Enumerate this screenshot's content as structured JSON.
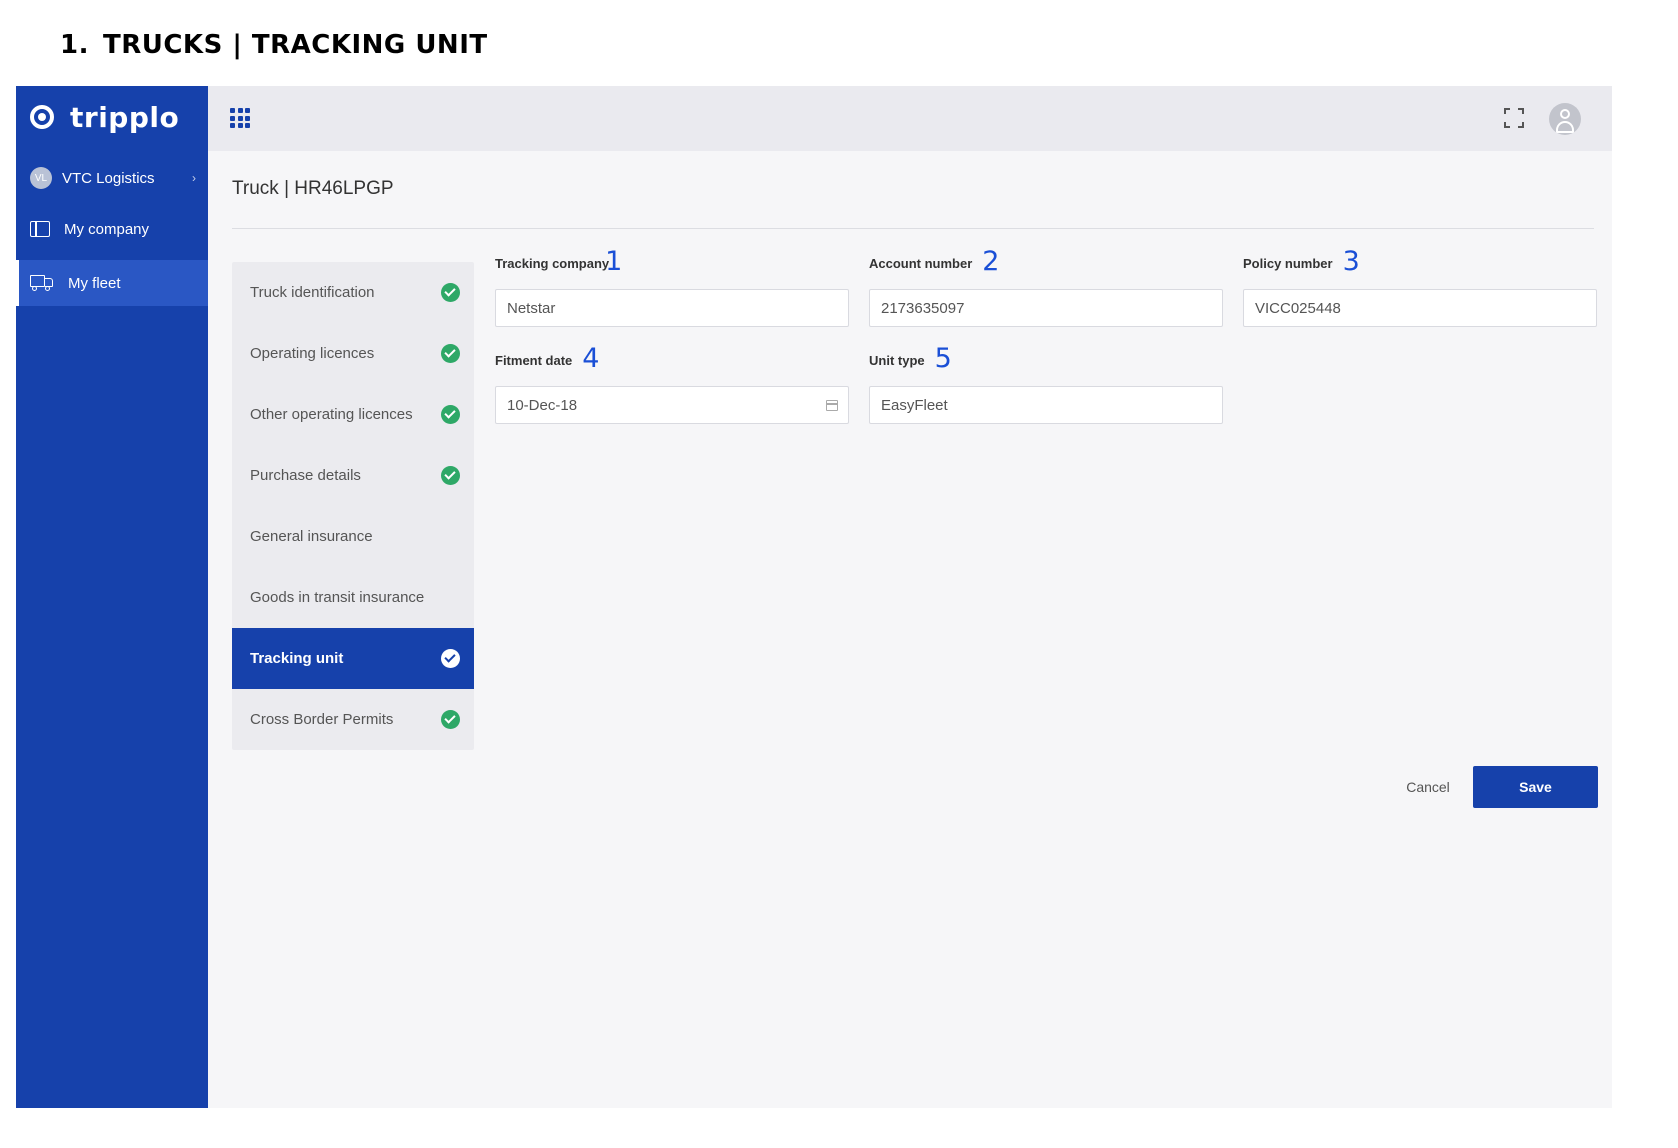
{
  "document": {
    "section_number": "1.",
    "heading": "TRUCKS | TRACKING UNIT"
  },
  "sidebar": {
    "brand": "tripplo",
    "company": {
      "initials": "VL",
      "name": "VTC Logistics",
      "chevron": "›"
    },
    "items": [
      {
        "label": "My company",
        "icon": "building-icon",
        "active": false
      },
      {
        "label": "My fleet",
        "icon": "truck-icon",
        "active": true
      }
    ]
  },
  "topbar": {
    "apps_icon": "grid-icon",
    "fullscreen_icon": "expand-icon",
    "user_icon": "user-avatar-icon"
  },
  "page": {
    "title": "Truck | HR46LPGP"
  },
  "steps": [
    {
      "label": "Truck identification",
      "done": true
    },
    {
      "label": "Operating licences",
      "done": true
    },
    {
      "label": "Other operating licences",
      "done": true
    },
    {
      "label": "Purchase details",
      "done": true
    },
    {
      "label": "General insurance",
      "done": false
    },
    {
      "label": "Goods in transit insurance",
      "done": false
    },
    {
      "label": "Tracking unit",
      "done": true,
      "active": true
    },
    {
      "label": "Cross Border Permits",
      "done": true
    }
  ],
  "form": {
    "tracking_company": {
      "label": "Tracking company",
      "marker": "1",
      "value": "Netstar"
    },
    "account_number": {
      "label": "Account number",
      "marker": "2",
      "value": "2173635097"
    },
    "policy_number": {
      "label": "Policy number",
      "marker": "3",
      "value": "VICC025448"
    },
    "fitment_date": {
      "label": "Fitment date",
      "marker": "4",
      "value": "10-Dec-18"
    },
    "unit_type": {
      "label": "Unit type",
      "marker": "5",
      "value": "EasyFleet"
    }
  },
  "actions": {
    "cancel": "Cancel",
    "save": "Save"
  },
  "colors": {
    "brand_blue": "#1641ab",
    "success_green": "#2ea867",
    "annotation_blue": "#1a4fd6"
  }
}
